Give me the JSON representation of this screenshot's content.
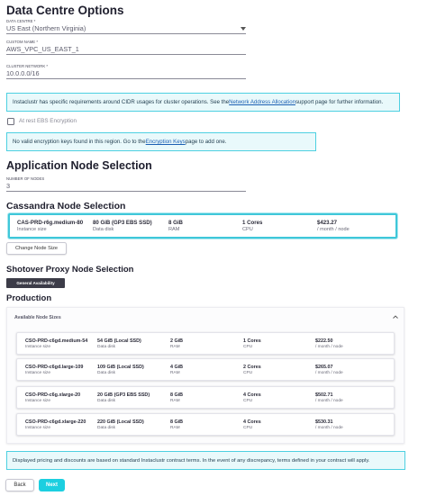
{
  "data_centre": {
    "title": "Data Centre Options",
    "data_centre_label": "DATA CENTRE *",
    "data_centre_value": "US East (Northern Virginia)",
    "custom_name_label": "CUSTOM NAME *",
    "custom_name_value": "AWS_VPC_US_EAST_1",
    "cluster_network_label": "CLUSTER NETWORK *",
    "cluster_network_value": "10.0.0.0/16",
    "cidr_notice": {
      "before": "Instaclustr has specific requirements around CIDR usages for cluster operations. See the ",
      "link": "Network Address Allocation",
      "after": " support page for further information."
    },
    "encryption_checkbox_label": "At rest EBS Encryption",
    "encryption_notice": {
      "before": "No valid encryption keys found in this region. Go to the ",
      "link": "Encryption Keys",
      "after": " page to add one."
    }
  },
  "app_nodes": {
    "title": "Application Node Selection",
    "nodes_label": "NUMBER OF NODES",
    "nodes_value": "3"
  },
  "cassandra": {
    "title": "Cassandra Node Selection",
    "selected": {
      "size": "CAS-PRD-r6g.medium-80",
      "size_label": "Instance size",
      "disk": "80 GiB (GP3 EBS SSD)",
      "disk_label": "Data disk",
      "ram": "8 GiB",
      "ram_label": "RAM",
      "cpu": "1 Cores",
      "cpu_label": "CPU",
      "price": "$423.27",
      "price_label": "/ month / node"
    },
    "change_button": "Change Node Size"
  },
  "shotover": {
    "title": "Shotover Proxy Node Selection",
    "badge": "General Availability",
    "production_title": "Production",
    "panel_title": "Available Node Sizes",
    "nodes": [
      {
        "size": "CSO-PRD-c6gd.medium-54",
        "size_label": "Instance size",
        "disk": "54 GiB (Local SSD)",
        "disk_label": "Data disk",
        "ram": "2 GiB",
        "ram_label": "RAM",
        "cpu": "1 Cores",
        "cpu_label": "CPU",
        "price": "$222.50",
        "price_label": "/ month / node"
      },
      {
        "size": "CSO-PRD-c6gd.large-109",
        "size_label": "Instance size",
        "disk": "109 GiB (Local SSD)",
        "disk_label": "Data disk",
        "ram": "4 GiB",
        "ram_label": "RAM",
        "cpu": "2 Cores",
        "cpu_label": "CPU",
        "price": "$265.07",
        "price_label": "/ month / node"
      },
      {
        "size": "CSO-PRD-c6g.xlarge-20",
        "size_label": "Instance size",
        "disk": "20 GiB (GP3 EBS SSD)",
        "disk_label": "Data disk",
        "ram": "8 GiB",
        "ram_label": "RAM",
        "cpu": "4 Cores",
        "cpu_label": "CPU",
        "price": "$502.71",
        "price_label": "/ month / node"
      },
      {
        "size": "CSO-PRD-c6gd.xlarge-220",
        "size_label": "Instance size",
        "disk": "220 GiB (Local SSD)",
        "disk_label": "Data disk",
        "ram": "8 GiB",
        "ram_label": "RAM",
        "cpu": "4 Cores",
        "cpu_label": "CPU",
        "price": "$530.31",
        "price_label": "/ month / node"
      }
    ]
  },
  "pricing_notice": "Displayed pricing and discounts are based on standard Instaclustr contract terms. In the event of any discrepancy, terms defined in your contract will apply.",
  "footer": {
    "back": "Back",
    "next": "Next"
  },
  "icons": {
    "dropdown": "caret-down-icon",
    "collapse": "chevron-up-icon"
  },
  "colors": {
    "accent": "#1ccfe0",
    "selected_border": "#3fc7d9",
    "notice_bg": "#e9f9fb",
    "badge_bg": "#3c3c48",
    "link": "#1b5fb3"
  }
}
